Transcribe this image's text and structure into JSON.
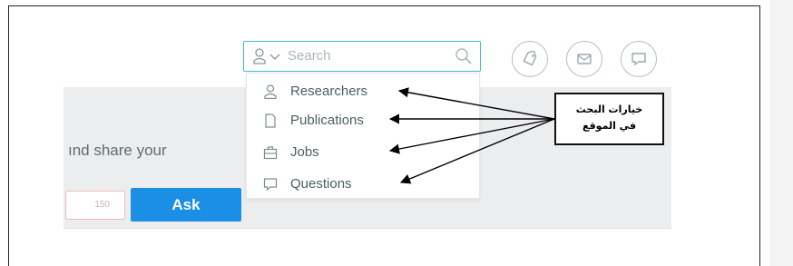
{
  "search": {
    "placeholder": "Search",
    "scope_icon": "user-icon",
    "dropdown_icon": "chevron-down-icon",
    "submit_icon": "search-icon"
  },
  "header_buttons": [
    {
      "name": "tag-icon"
    },
    {
      "name": "mail-icon"
    },
    {
      "name": "chat-icon"
    }
  ],
  "dropdown": {
    "items": [
      {
        "label": "Researchers",
        "icon": "researcher-icon"
      },
      {
        "label": "Publications",
        "icon": "document-icon"
      },
      {
        "label": "Jobs",
        "icon": "briefcase-icon"
      },
      {
        "label": "Questions",
        "icon": "question-bubble-icon"
      }
    ]
  },
  "ask": {
    "intro_text": "ınd share your",
    "counter": "150",
    "button_label": "Ask"
  },
  "annotation": {
    "line1": "خيارات البحث",
    "line2": "في الموقع"
  },
  "colors": {
    "accent": "#3fbcc8",
    "ask_button": "#1b8fe6",
    "band": "#ecedee",
    "text": "#4e5d64"
  }
}
